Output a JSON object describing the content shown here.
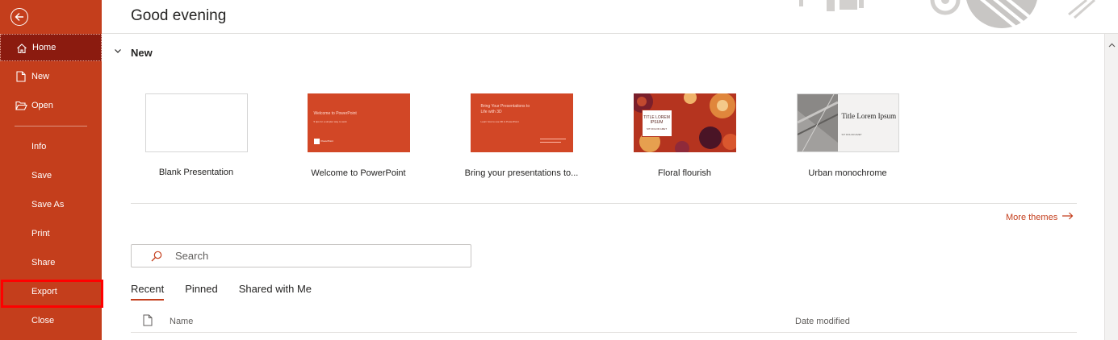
{
  "sidebar": {
    "items": [
      {
        "label": "Home",
        "icon": "home-icon"
      },
      {
        "label": "New",
        "icon": "new-file-icon"
      },
      {
        "label": "Open",
        "icon": "folder-open-icon"
      },
      {
        "label": "Info"
      },
      {
        "label": "Save"
      },
      {
        "label": "Save As"
      },
      {
        "label": "Print"
      },
      {
        "label": "Share"
      },
      {
        "label": "Export"
      },
      {
        "label": "Close"
      }
    ]
  },
  "header": {
    "greeting": "Good evening"
  },
  "new_section": {
    "title": "New",
    "templates": [
      {
        "label": "Blank Presentation"
      },
      {
        "label": "Welcome to PowerPoint",
        "thumb_title": "Welcome to PowerPoint",
        "thumb_sub": "5 tips for a simpler way to work",
        "thumb_brand": "PowerPoint"
      },
      {
        "label": "Bring your presentations to...",
        "thumb_title": "Bring Your Presentations to Life with 3D",
        "thumb_sub": "Learn how to use 3D in PowerPoint"
      },
      {
        "label": "Floral flourish",
        "thumb_title": "TITLE LOREM IPSUM",
        "thumb_sub": "SIT DOLOR AMET"
      },
      {
        "label": "Urban monochrome",
        "thumb_title": "Title Lorem Ipsum",
        "thumb_sub": "SIT DOLOR AMET"
      }
    ],
    "more_themes": "More themes"
  },
  "search": {
    "placeholder": "Search"
  },
  "tabs": [
    {
      "label": "Recent",
      "active": true
    },
    {
      "label": "Pinned"
    },
    {
      "label": "Shared with Me"
    }
  ],
  "file_list": {
    "col_name": "Name",
    "col_date": "Date modified"
  },
  "colors": {
    "accent": "#c43e1c",
    "active_item": "#8b1b0f",
    "highlight": "#ff0000"
  }
}
